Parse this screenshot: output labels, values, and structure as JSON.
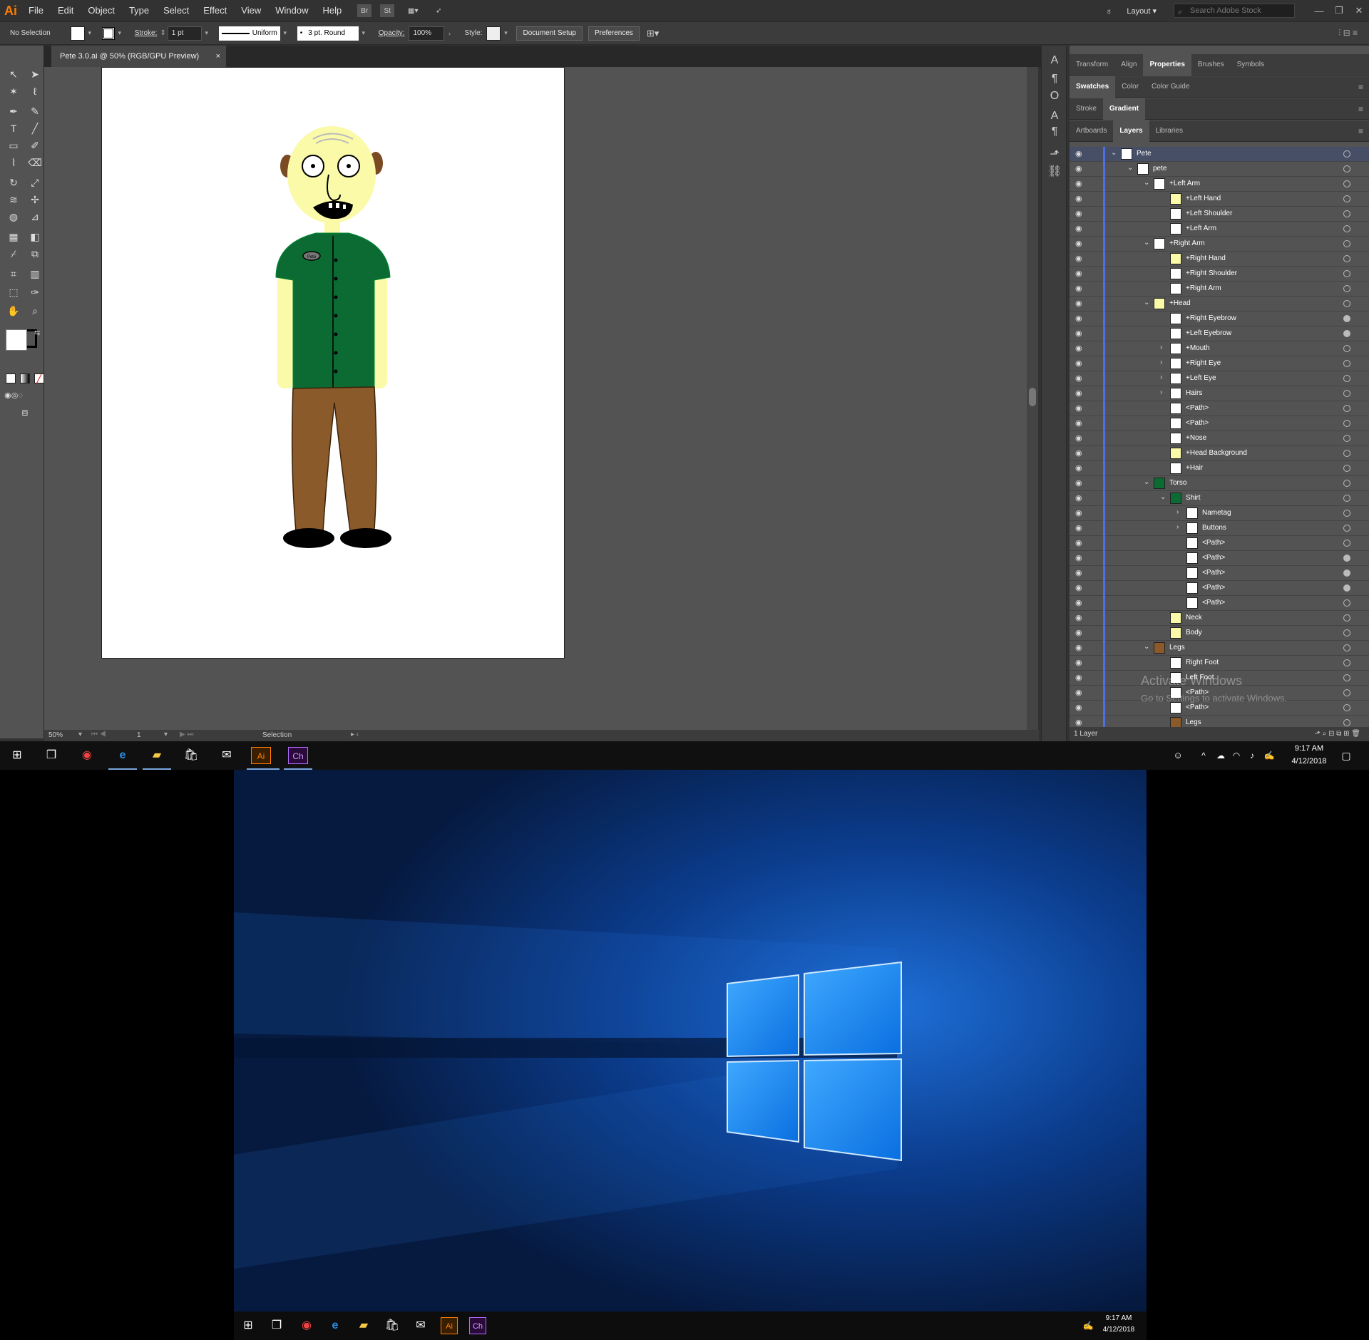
{
  "app": {
    "logo": "Ai",
    "menus": [
      "File",
      "Edit",
      "Object",
      "Type",
      "Select",
      "Effect",
      "View",
      "Window",
      "Help"
    ],
    "bridge_buttons": [
      "Br",
      "St"
    ],
    "workspace": "Layout",
    "search_placeholder": "Search Adobe Stock"
  },
  "control": {
    "selection_label": "No Selection",
    "stroke_label": "Stroke:",
    "stroke_value": "1 pt",
    "stroke_style": "Uniform",
    "brush": "3 pt. Round",
    "opacity_label": "Opacity:",
    "opacity_value": "100%",
    "style_label": "Style:",
    "document_setup": "Document Setup",
    "preferences": "Preferences"
  },
  "document": {
    "tab_title": "Pete 3.0.ai @ 50% (RGB/GPU Preview)",
    "close": "×",
    "nametag": "Pete"
  },
  "status": {
    "zoom": "50%",
    "artboard": "1",
    "tool": "Selection"
  },
  "panels": {
    "row1": [
      "Transform",
      "Align",
      "Properties",
      "Brushes",
      "Symbols"
    ],
    "row2": [
      "Swatches",
      "Color",
      "Color Guide"
    ],
    "row3": [
      "Stroke",
      "Gradient"
    ],
    "row4": [
      "Artboards",
      "Layers",
      "Libraries"
    ]
  },
  "layers": [
    {
      "name": "Pete",
      "indent": 0,
      "twist": "down",
      "selected": true
    },
    {
      "name": "pete",
      "indent": 1,
      "twist": "down"
    },
    {
      "name": "+Left Arm",
      "indent": 2,
      "twist": "down"
    },
    {
      "name": "+Left Hand",
      "indent": 3
    },
    {
      "name": "+Left Shoulder",
      "indent": 3
    },
    {
      "name": "+Left Arm",
      "indent": 3
    },
    {
      "name": "+Right Arm",
      "indent": 2,
      "twist": "down"
    },
    {
      "name": "+Right Hand",
      "indent": 3
    },
    {
      "name": "+Right Shoulder",
      "indent": 3
    },
    {
      "name": "+Right Arm",
      "indent": 3
    },
    {
      "name": "+Head",
      "indent": 2,
      "twist": "down"
    },
    {
      "name": "+Right Eyebrow",
      "indent": 3,
      "filled": true
    },
    {
      "name": "+Left Eyebrow",
      "indent": 3,
      "filled": true
    },
    {
      "name": "+Mouth",
      "indent": 3,
      "twist": "right"
    },
    {
      "name": "+Right Eye",
      "indent": 3,
      "twist": "right"
    },
    {
      "name": "+Left Eye",
      "indent": 3,
      "twist": "right"
    },
    {
      "name": "Hairs",
      "indent": 3,
      "twist": "right"
    },
    {
      "name": "<Path>",
      "indent": 3
    },
    {
      "name": "<Path>",
      "indent": 3
    },
    {
      "name": "+Nose",
      "indent": 3
    },
    {
      "name": "+Head Background",
      "indent": 3
    },
    {
      "name": "+Hair",
      "indent": 3
    },
    {
      "name": "Torso",
      "indent": 2,
      "twist": "down"
    },
    {
      "name": "Shirt",
      "indent": 3,
      "twist": "down"
    },
    {
      "name": "Nametag",
      "indent": 4,
      "twist": "right"
    },
    {
      "name": "Buttons",
      "indent": 4,
      "twist": "right"
    },
    {
      "name": "<Path>",
      "indent": 4
    },
    {
      "name": "<Path>",
      "indent": 4,
      "filled": true
    },
    {
      "name": "<Path>",
      "indent": 4,
      "filled": true
    },
    {
      "name": "<Path>",
      "indent": 4,
      "filled": true
    },
    {
      "name": "<Path>",
      "indent": 4
    },
    {
      "name": "Neck",
      "indent": 3
    },
    {
      "name": "Body",
      "indent": 3
    },
    {
      "name": "Legs",
      "indent": 2,
      "twist": "down"
    },
    {
      "name": "Right Foot",
      "indent": 3
    },
    {
      "name": "Left Foot",
      "indent": 3
    },
    {
      "name": "<Path>",
      "indent": 3
    },
    {
      "name": "<Path>",
      "indent": 3
    },
    {
      "name": "Legs",
      "indent": 3
    }
  ],
  "layers_footer": "1 Layer",
  "watermark": {
    "line1": "Activate Windows",
    "line2": "Go to Settings to activate Windows."
  },
  "taskbar": {
    "time": "9:17 AM",
    "date": "4/12/2018",
    "ai": "Ai",
    "ch": "Ch"
  },
  "colors": {
    "shirt": "#0c6b33",
    "pants": "#8b5a2b",
    "skin": "#fafaa8",
    "accent": "#ff7c00"
  }
}
